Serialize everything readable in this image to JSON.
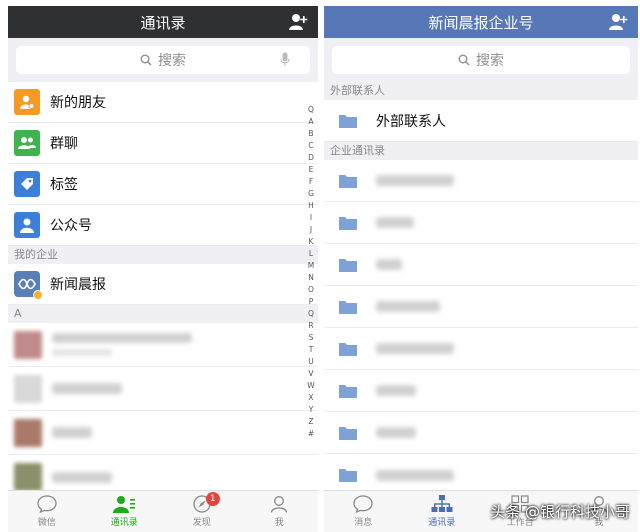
{
  "left": {
    "title": "通讯录",
    "search_placeholder": "搜索",
    "items": [
      {
        "label": "新的朋友",
        "color": "#f59a23"
      },
      {
        "label": "群聊",
        "color": "#3fb34f"
      },
      {
        "label": "标签",
        "color": "#3c7fd8"
      },
      {
        "label": "公众号",
        "color": "#3c7fd8"
      }
    ],
    "section_company": "我的企业",
    "company_name": "新闻晨报",
    "section_a": "A",
    "alphabet": [
      "Q",
      "A",
      "B",
      "C",
      "D",
      "E",
      "F",
      "G",
      "H",
      "I",
      "J",
      "K",
      "L",
      "M",
      "N",
      "O",
      "P",
      "Q",
      "R",
      "S",
      "T",
      "U",
      "V",
      "W",
      "X",
      "Y",
      "Z",
      "#"
    ],
    "tabs": [
      {
        "label": "微信",
        "icon": "chat-icon"
      },
      {
        "label": "通讯录",
        "icon": "contacts-icon"
      },
      {
        "label": "发现",
        "icon": "compass-icon",
        "badge": "1"
      },
      {
        "label": "我",
        "icon": "person-icon"
      }
    ]
  },
  "right": {
    "title": "新闻晨报企业号",
    "search_placeholder": "搜索",
    "section_external": "外部联系人",
    "external_label": "外部联系人",
    "section_directory": "企业通讯录",
    "tabs": [
      {
        "label": "消息",
        "icon": "chat-icon"
      },
      {
        "label": "通讯录",
        "icon": "org-chart-icon"
      },
      {
        "label": "工作台",
        "icon": "grid-icon"
      },
      {
        "label": "我",
        "icon": "person-icon"
      }
    ]
  },
  "watermark": "头条 @银行科技小哥",
  "colors": {
    "accent_green": "#1aad19",
    "accent_blue": "#4a6fb0",
    "header_dark": "#2f3033",
    "header_blue": "#5678b6"
  }
}
